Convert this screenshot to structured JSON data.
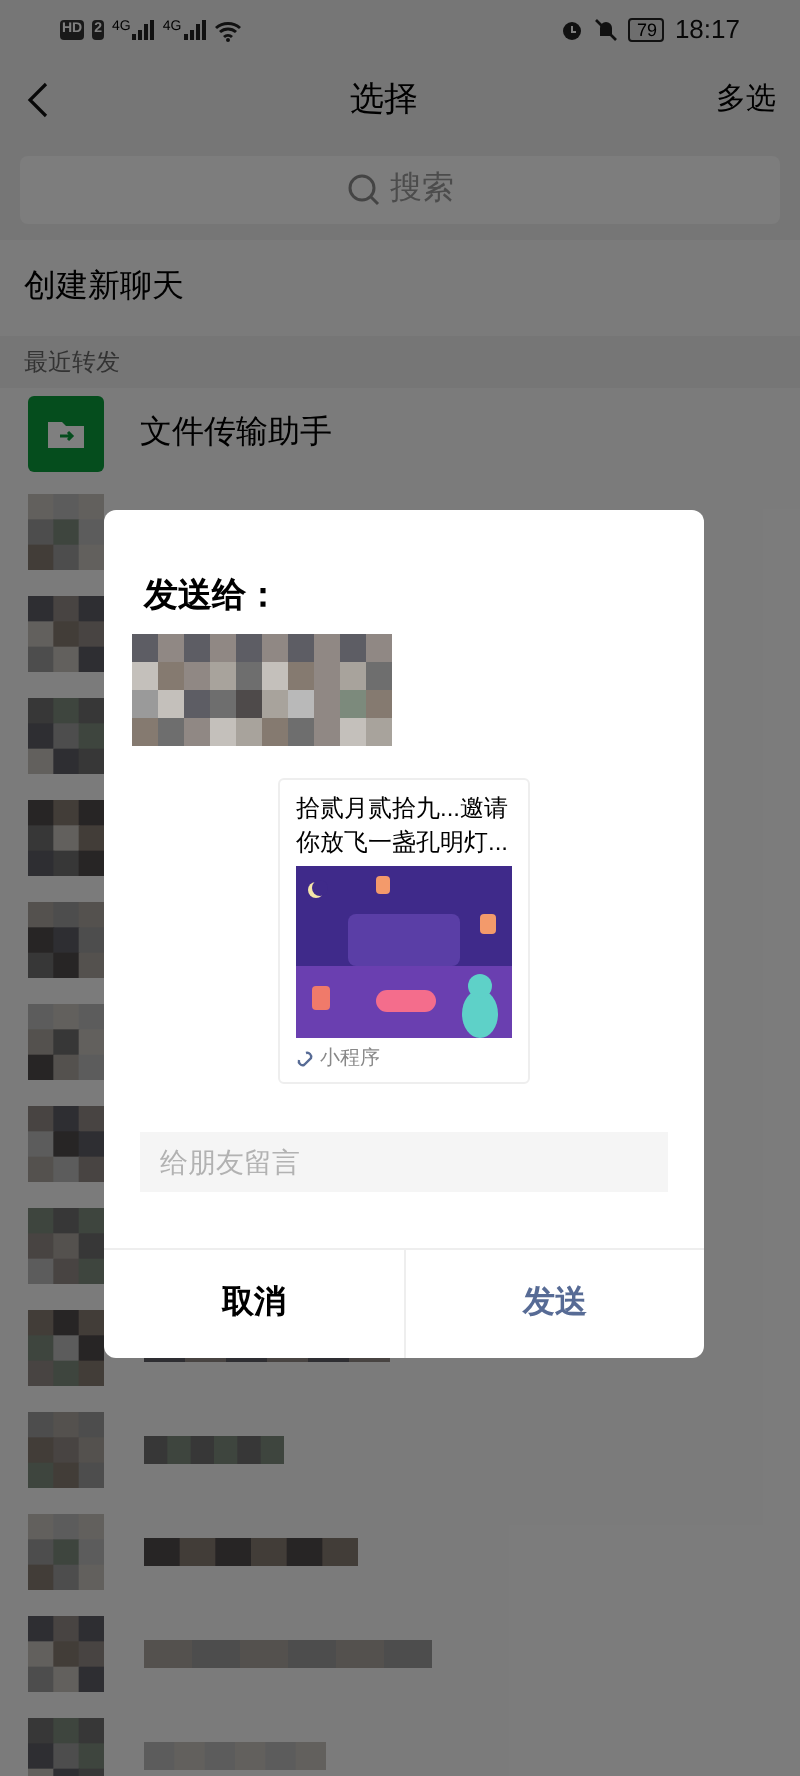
{
  "status_bar": {
    "badges": [
      "HD",
      "2"
    ],
    "networks": [
      "4G",
      "4G"
    ],
    "battery": "79",
    "time": "18:17"
  },
  "nav": {
    "title": "选择",
    "action": "多选"
  },
  "search": {
    "placeholder": "搜索"
  },
  "new_chat": "创建新聊天",
  "section": "最近转发",
  "contacts": [
    {
      "kind": "file",
      "name": "文件传输助手"
    },
    {
      "kind": "avatar"
    },
    {
      "kind": "avatar"
    },
    {
      "kind": "avatar"
    },
    {
      "kind": "avatar"
    },
    {
      "kind": "avatar"
    },
    {
      "kind": "avatar"
    },
    {
      "kind": "avatar"
    },
    {
      "kind": "avatar"
    },
    {
      "kind": "picture"
    },
    {
      "kind": "picture"
    },
    {
      "kind": "picture"
    },
    {
      "kind": "picture"
    },
    {
      "kind": "picture"
    }
  ],
  "dialog": {
    "title": "发送给：",
    "recipient": {
      "kind": "picture"
    },
    "card": {
      "title": "拾贰月贰拾九...邀请你放飞一盏孔明灯...",
      "image": {
        "kind": "picture"
      },
      "source": "小程序"
    },
    "message": {
      "placeholder": "给朋友留言"
    },
    "buttons": [
      {
        "kind": "cancel",
        "label": "取消"
      },
      {
        "kind": "send",
        "label": "发送"
      }
    ]
  }
}
